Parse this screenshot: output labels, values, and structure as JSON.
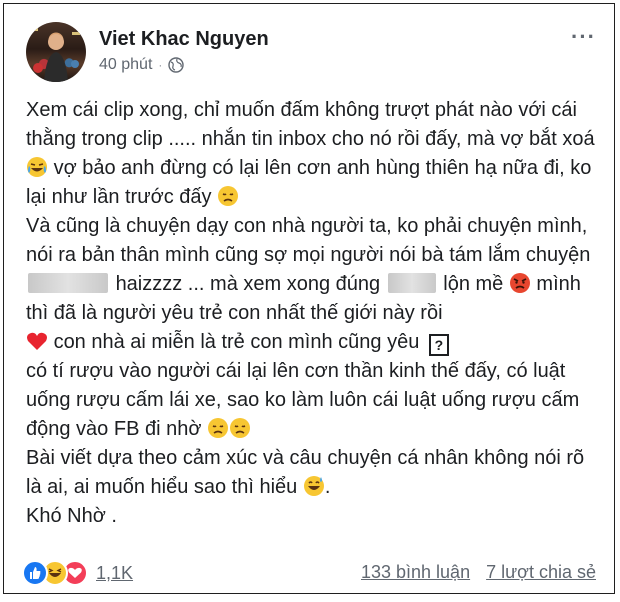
{
  "post": {
    "author": "Viet Khac Nguyen",
    "time": "40 phút",
    "separator": "·",
    "more": "···",
    "lines": {
      "l1": "Xem cái clip xong, chỉ muốn đấm không trượt phát nào với cái thằng trong clip .....  nhắn tin inbox cho nó rồi đấy, mà vợ bắt xoá",
      "l1b": " vợ bảo anh đừng có lại lên cơn anh hùng thiên hạ nữa đi, ko lại như lần trước đấy ",
      "l2a": "Và cũng là chuyện  dạy con  nhà người ta, ko phải chuyện mình, nói ra bản thân mình cũng sợ mọi người nói bà tám lắm chuyện",
      "l2b": "haizzzz ...  mà xem xong đúng",
      "l2c": " lộn mề ",
      "l2d": " mình thì đã là người yêu trẻ con nhất thế giới này rồi",
      "l3a": " con nhà ai miễn là trẻ con   mình cũng yêu",
      "q": "?",
      "l4": "có tí rượu vào người cái lại lên cơn thần kinh thế đấy, có luật uống rượu cấm lái xe, sao ko làm luôn cái luật uống rượu cấm động vào FB đi nhờ ",
      "l5a": "Bài viết dựa theo cảm xúc và câu chuyện cá nhân không nói rõ là ai, ai muốn hiểu sao thì hiểu ",
      "l5b": ".",
      "l6": "Khó Nhờ ."
    }
  },
  "footer": {
    "reaction_count": "1,1K",
    "comments": "133 bình luận",
    "shares": "7 lượt chia sẻ"
  },
  "colors": {
    "like": "#1877f2",
    "haha": "#f7c632",
    "love": "#f33e58"
  }
}
